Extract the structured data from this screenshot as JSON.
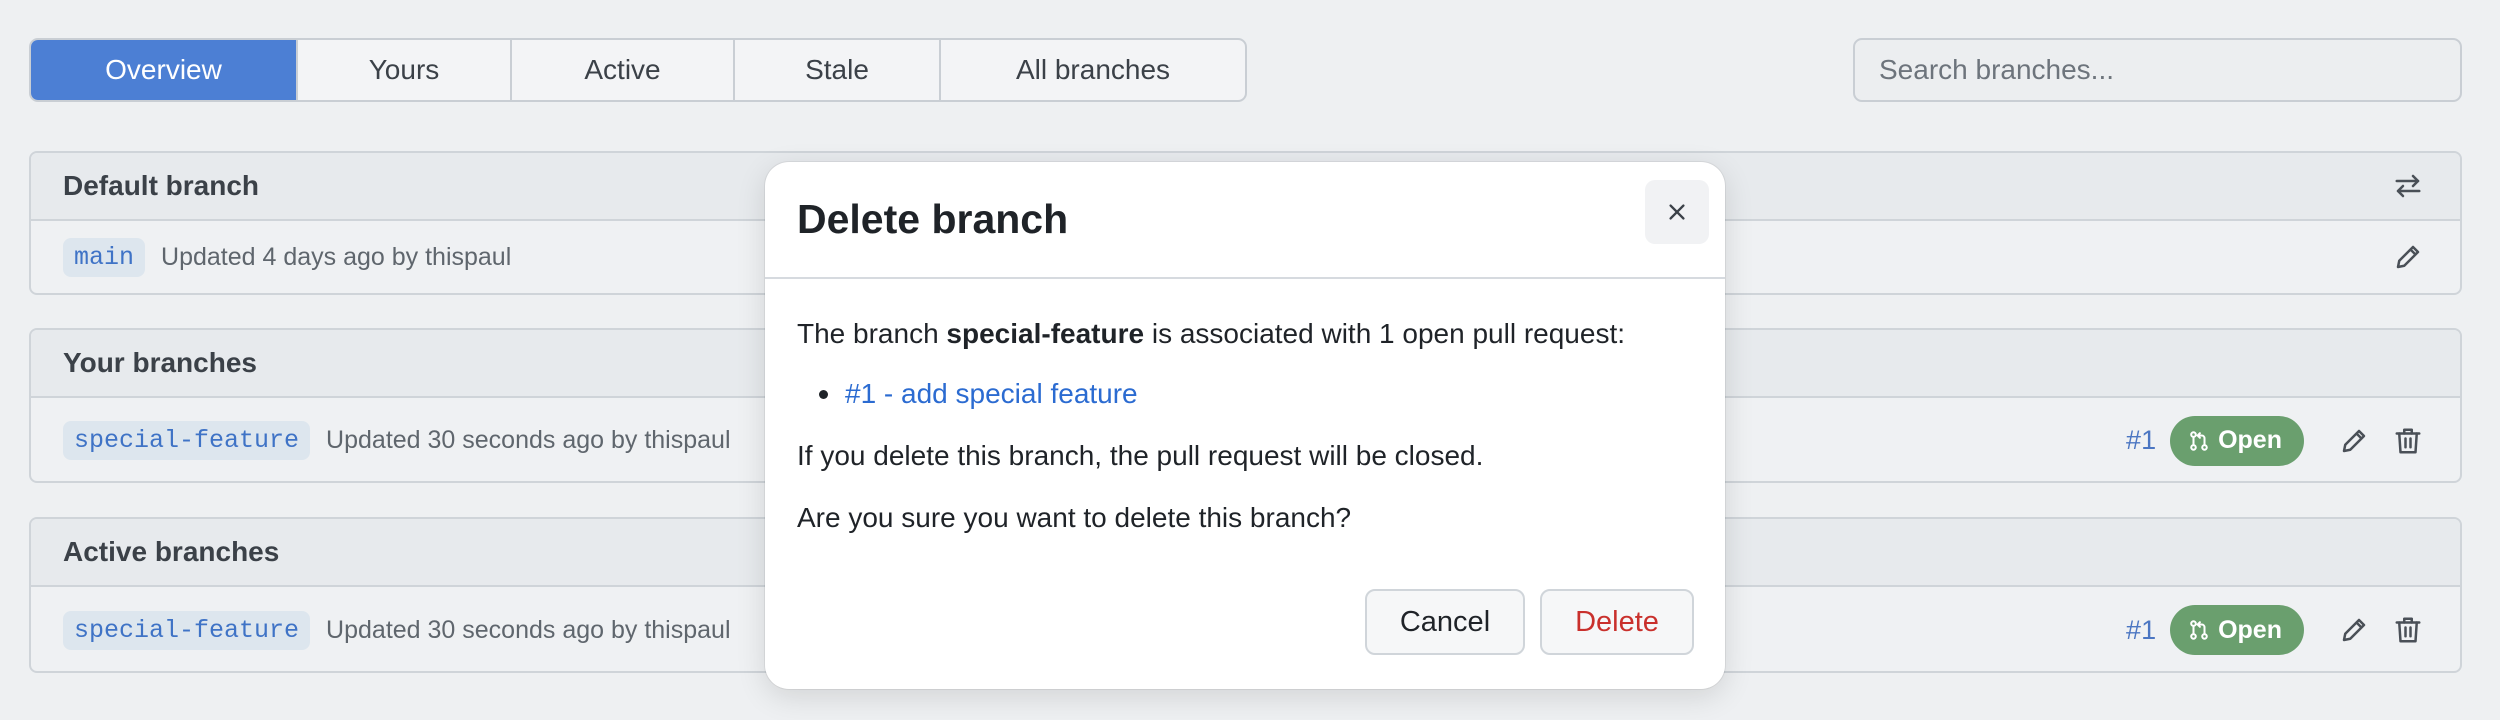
{
  "tabs": [
    {
      "label": "Overview",
      "active": true
    },
    {
      "label": "Yours",
      "active": false
    },
    {
      "label": "Active",
      "active": false
    },
    {
      "label": "Stale",
      "active": false
    },
    {
      "label": "All branches",
      "active": false
    }
  ],
  "search": {
    "placeholder": "Search branches..."
  },
  "default_branch": {
    "title": "Default branch",
    "branch": "main",
    "updated": "Updated 4 days ago by thispaul"
  },
  "your_branches": {
    "title": "Your branches",
    "branch": "special-feature",
    "updated": "Updated 30 seconds ago by thispaul",
    "pr_number": "#1",
    "pr_status": "Open"
  },
  "active_branches": {
    "title": "Active branches",
    "branch": "special-feature",
    "updated": "Updated 30 seconds ago by thispaul",
    "pr_number": "#1",
    "pr_status": "Open"
  },
  "modal": {
    "title": "Delete branch",
    "text_before": "The branch ",
    "branch_name": "special-feature",
    "text_after": " is associated with 1 open pull request:",
    "pr_link": "#1 - add special feature",
    "warning": "If you delete this branch, the pull request will be closed.",
    "question": "Are you sure you want to delete this branch?",
    "cancel_label": "Cancel",
    "delete_label": "Delete"
  },
  "colors": {
    "accent": "#4c7fd4",
    "open_badge": "#6a9f6e",
    "link": "#2b6bd1",
    "danger": "#c9302c"
  }
}
